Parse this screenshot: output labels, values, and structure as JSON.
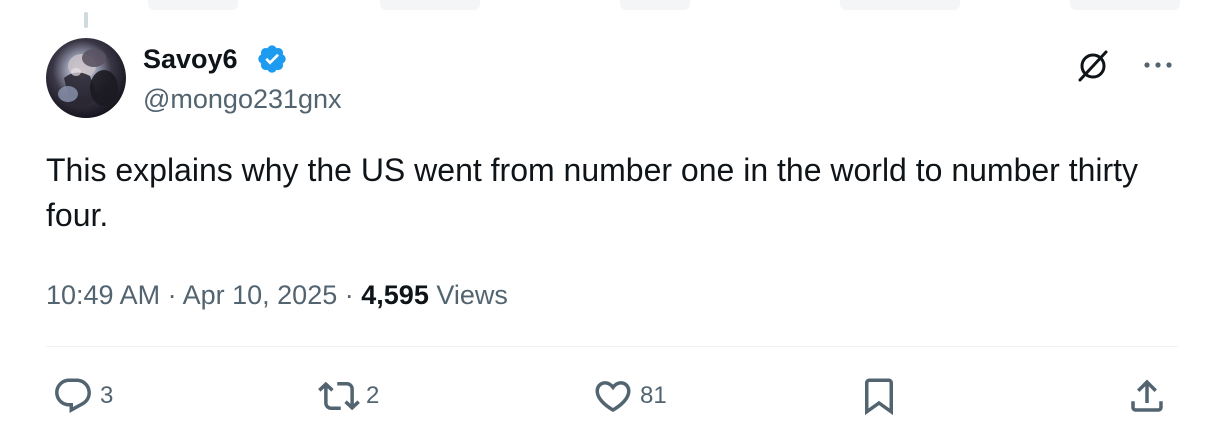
{
  "tweet": {
    "display_name": "Savoy6",
    "handle": "@mongo231gnx",
    "verified": true,
    "text": "This explains why the US went from number one in the world to number thirty four.",
    "time": "10:49 AM",
    "date": "Apr 10, 2025",
    "separator": "·",
    "views_count": "4,595",
    "views_label": "Views"
  },
  "actions": {
    "replies": "3",
    "reposts": "2",
    "likes": "81"
  },
  "icons": {
    "verified": "verified-badge-icon",
    "grok": "grok-icon",
    "more": "more-icon",
    "reply": "reply-icon",
    "repost": "repost-icon",
    "like": "heart-icon",
    "bookmark": "bookmark-icon",
    "share": "share-icon"
  },
  "colors": {
    "text": "#0f1419",
    "secondary": "#536471",
    "verified": "#1d9bf0",
    "divider": "#eff3f4"
  }
}
